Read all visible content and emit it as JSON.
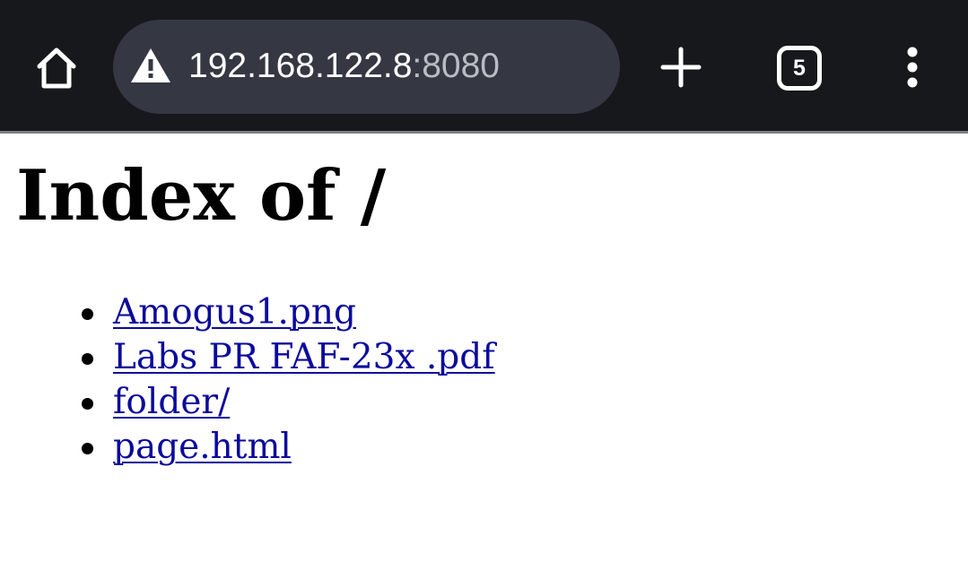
{
  "browser": {
    "url_host": "192.168.122.8",
    "url_port": ":8080",
    "tab_count": "5",
    "icons": {
      "home": "home-icon",
      "security": "warning-triangle-icon",
      "new_tab": "plus-icon",
      "tabs": "tab-switcher-icon",
      "menu": "more-vert-icon"
    }
  },
  "page": {
    "heading": "Index of /",
    "files": [
      {
        "name": "Amogus1.png"
      },
      {
        "name": "Labs PR FAF-23x .pdf"
      },
      {
        "name": "folder/"
      },
      {
        "name": "page.html"
      }
    ],
    "link_color": "#0b0a9c"
  }
}
